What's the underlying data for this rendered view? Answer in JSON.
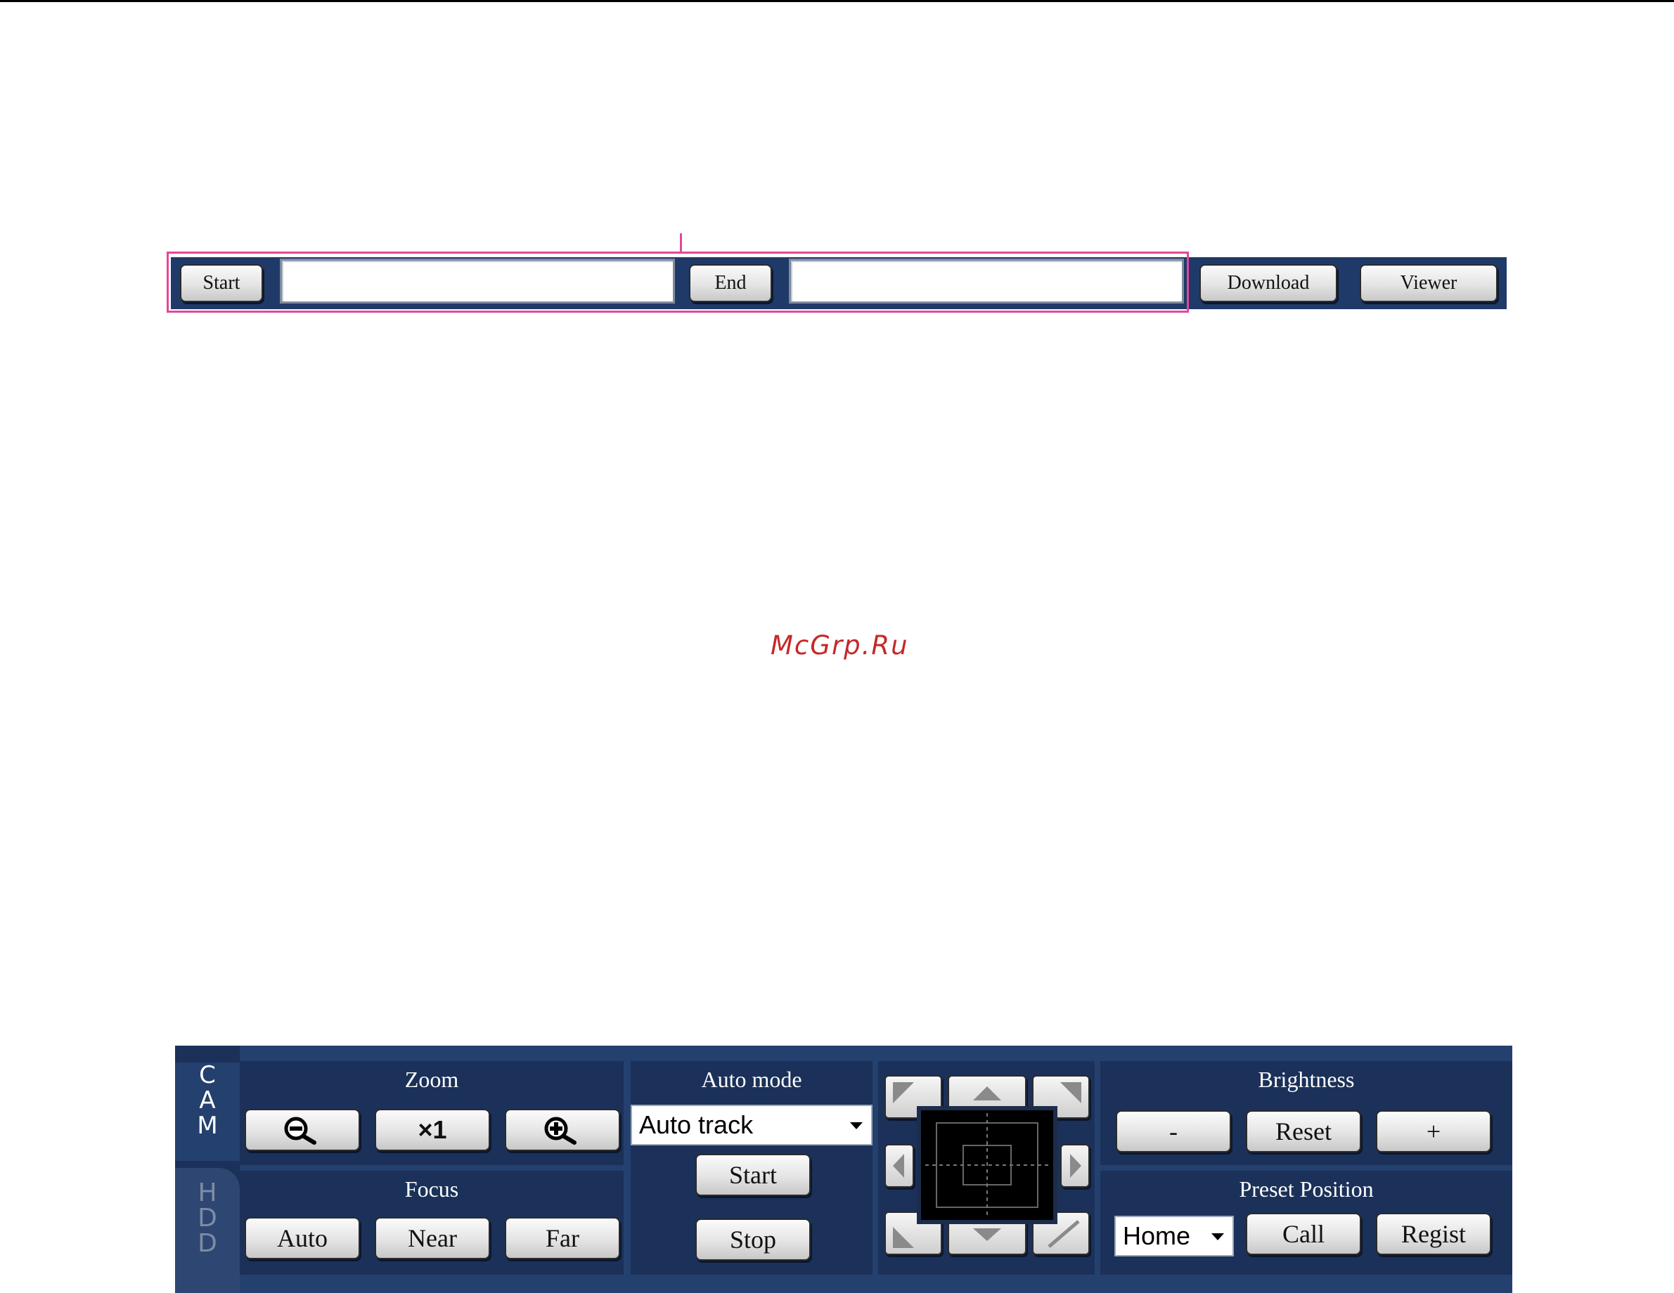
{
  "download_toolbar": {
    "start_label": "Start",
    "start_value": "",
    "end_label": "End",
    "end_value": "",
    "download_label": "Download",
    "viewer_label": "Viewer"
  },
  "watermark": "McGrp.Ru",
  "control_panel": {
    "tabs": [
      {
        "label": "CAM",
        "letters": [
          "C",
          "A",
          "M"
        ],
        "active": true
      },
      {
        "label": "HDD",
        "letters": [
          "H",
          "D",
          "D"
        ],
        "active": false
      }
    ],
    "zoom": {
      "title": "Zoom",
      "zoom_out_icon": "zoom-out-magnifier-icon",
      "reset_label": "×1",
      "zoom_in_icon": "zoom-in-magnifier-icon"
    },
    "focus": {
      "title": "Focus",
      "auto_label": "Auto",
      "near_label": "Near",
      "far_label": "Far"
    },
    "auto_mode": {
      "title": "Auto mode",
      "selected": "Auto track",
      "start_label": "Start",
      "stop_label": "Stop"
    },
    "ptz_pad": {
      "icons": [
        "up-left-arrow-icon",
        "up-arrow-icon",
        "up-right-arrow-icon",
        "left-arrow-icon",
        "right-arrow-icon",
        "down-left-arrow-icon",
        "down-arrow-icon",
        "down-right-arrow-icon"
      ]
    },
    "brightness": {
      "title": "Brightness",
      "minus_label": "-",
      "reset_label": "Reset",
      "plus_label": "+"
    },
    "preset_position": {
      "title": "Preset Position",
      "selected": "Home",
      "call_label": "Call",
      "regist_label": "Regist"
    }
  },
  "colors": {
    "panel_bg": "#24406e",
    "section_bg": "#1b3159",
    "highlight": "#e0489a",
    "watermark": "#c62828"
  }
}
